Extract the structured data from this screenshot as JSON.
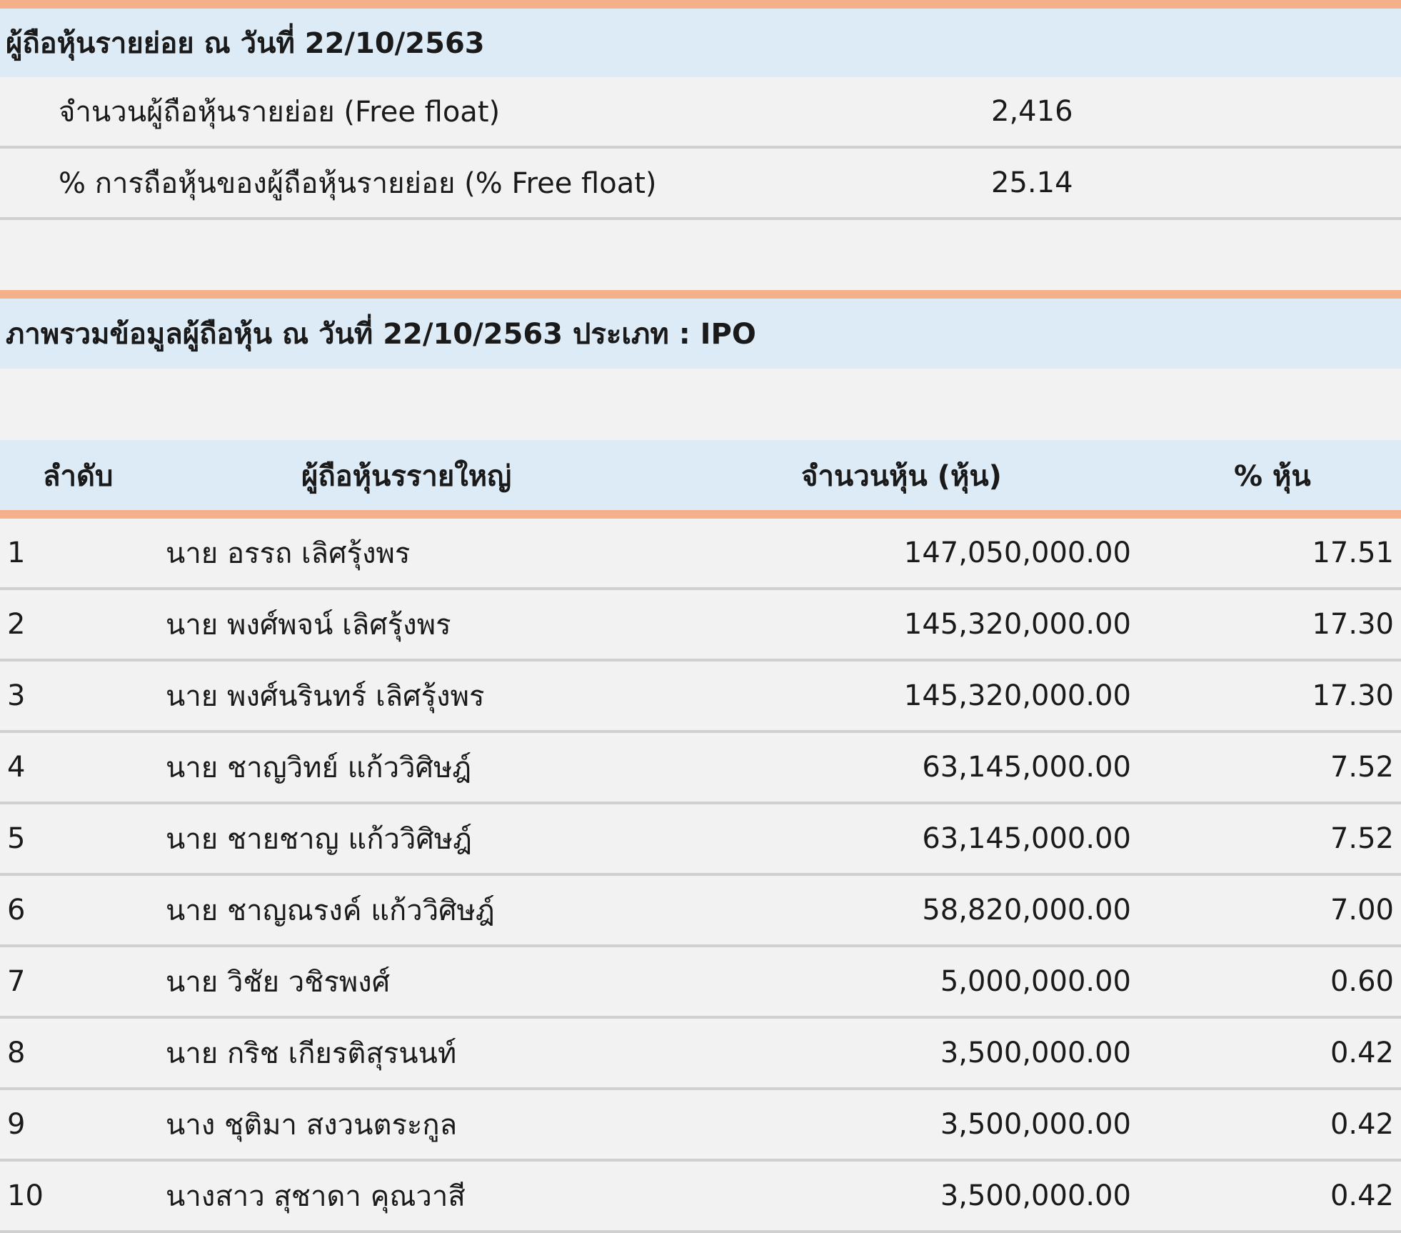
{
  "free_float": {
    "title": "ผู้ถือหุ้นรายย่อย ณ วันที่ 22/10/2563",
    "rows": [
      {
        "label": "จำนวนผู้ถือหุ้นรายย่อย (Free float)",
        "value": "2,416"
      },
      {
        "label": "% การถือหุ้นของผู้ถือหุ้นรายย่อย (% Free float)",
        "value": "25.14"
      }
    ]
  },
  "overview": {
    "title": "ภาพรวมข้อมูลผู้ถือหุ้น ณ วันที่ 22/10/2563 ประเภท : IPO"
  },
  "table": {
    "headers": {
      "rank": "ลำดับ",
      "name": "ผู้ถือหุ้นรรายใหญ่",
      "shares": "จำนวนหุ้น (หุ้น)",
      "pct": "% หุ้น"
    },
    "rows": [
      {
        "rank": "1",
        "name": "นาย อรรถ เลิศรุ้งพร",
        "shares": "147,050,000.00",
        "pct": "17.51"
      },
      {
        "rank": "2",
        "name": "นาย พงศ์พจน์ เลิศรุ้งพร",
        "shares": "145,320,000.00",
        "pct": "17.30"
      },
      {
        "rank": "3",
        "name": "นาย พงศ์นรินทร์ เลิศรุ้งพร",
        "shares": "145,320,000.00",
        "pct": "17.30"
      },
      {
        "rank": "4",
        "name": "นาย ชาญวิทย์ แก้ววิศิษฎ์",
        "shares": "63,145,000.00",
        "pct": "7.52"
      },
      {
        "rank": "5",
        "name": "นาย ชายชาญ แก้ววิศิษฎ์",
        "shares": "63,145,000.00",
        "pct": "7.52"
      },
      {
        "rank": "6",
        "name": "นาย ชาญณรงค์ แก้ววิศิษฎ์",
        "shares": "58,820,000.00",
        "pct": "7.00"
      },
      {
        "rank": "7",
        "name": "นาย วิชัย วชิรพงศ์",
        "shares": "5,000,000.00",
        "pct": "0.60"
      },
      {
        "rank": "8",
        "name": "นาย กริช เกียรติสุรนนท์",
        "shares": "3,500,000.00",
        "pct": "0.42"
      },
      {
        "rank": "9",
        "name": "นาง ชุติมา สงวนตระกูล",
        "shares": "3,500,000.00",
        "pct": "0.42"
      },
      {
        "rank": "10",
        "name": "นางสาว สุชาดา คุณวาสี",
        "shares": "3,500,000.00",
        "pct": "0.42"
      }
    ]
  },
  "colors": {
    "accent": "#f3b08b",
    "header_bg": "#ddebf7",
    "page_bg": "#f2f2f2",
    "divider": "#d0d0d0"
  }
}
